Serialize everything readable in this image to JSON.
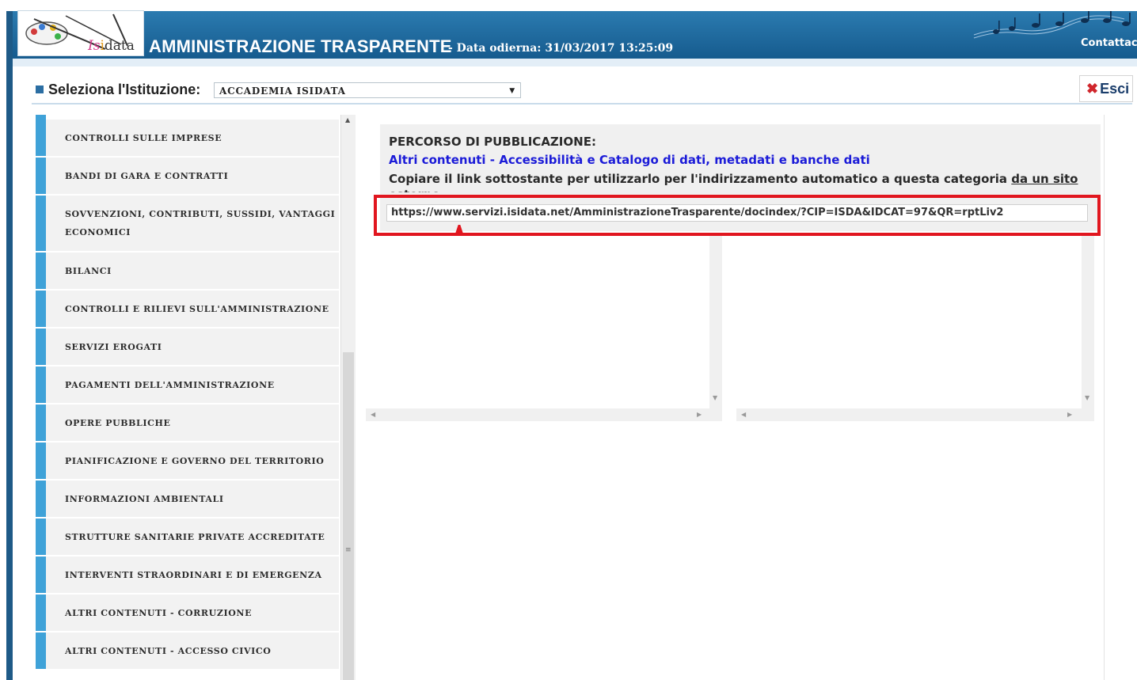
{
  "header": {
    "logo_text_is": "Is",
    "logo_text_i": "i",
    "logo_text_data": "data",
    "title": "AMMINISTRAZIONE TRASPARENTE",
    "date": "- Data odierna: 31/03/2017 13:25:09",
    "contact_label": "Contattac"
  },
  "istituzione": {
    "label": "Seleziona l'Istituzione:",
    "selected": "ACCADEMIA ISIDATA",
    "exit_label": "Esci"
  },
  "menu": {
    "items": [
      "CONTROLLI SULLE IMPRESE",
      "BANDI DI GARA E CONTRATTI",
      "SOVVENZIONI, CONTRIBUTI, SUSSIDI, VANTAGGI ECONOMICI",
      "BILANCI",
      "CONTROLLI E RILIEVI SULL'AMMINISTRAZIONE",
      "SERVIZI EROGATI",
      "PAGAMENTI DELL'AMMINISTRAZIONE",
      "OPERE PUBBLICHE",
      "PIANIFICAZIONE E GOVERNO DEL TERRITORIO",
      "INFORMAZIONI AMBIENTALI",
      "STRUTTURE SANITARIE PRIVATE ACCREDITATE",
      "INTERVENTI STRAORDINARI E DI EMERGENZA",
      "ALTRI CONTENUTI - CORRUZIONE",
      "ALTRI CONTENUTI - ACCESSO CIVICO"
    ]
  },
  "publication": {
    "heading": "PERCORSO DI PUBBLICAZIONE:",
    "path": "Altri contenuti - Accessibilità e Catalogo di dati, metadati e banche dati",
    "copy_text": "Copiare il link sottostante per utilizzarlo per l'indirizzamento automatico a questa categoria",
    "copy_link": "da un sito esterno",
    "url": "https://www.servizi.isidata.net/AmministrazioneTrasparente/docindex/?CIP=ISDA&IDCAT=97&QR=rptLiv2"
  },
  "icons": {
    "logo": "palette-logo-icon",
    "music": "music-notes-icon",
    "exit": "close-x-icon",
    "bullet": "grid-bullet-icon",
    "dropdown": "caret-down-icon",
    "annotation": "red-arrow-up-icon"
  },
  "colors": {
    "header_blue": "#1e5f94",
    "menu_accent": "#3fa2d8",
    "highlight_red": "#e1161f",
    "path_blue": "#1b1bd8"
  }
}
